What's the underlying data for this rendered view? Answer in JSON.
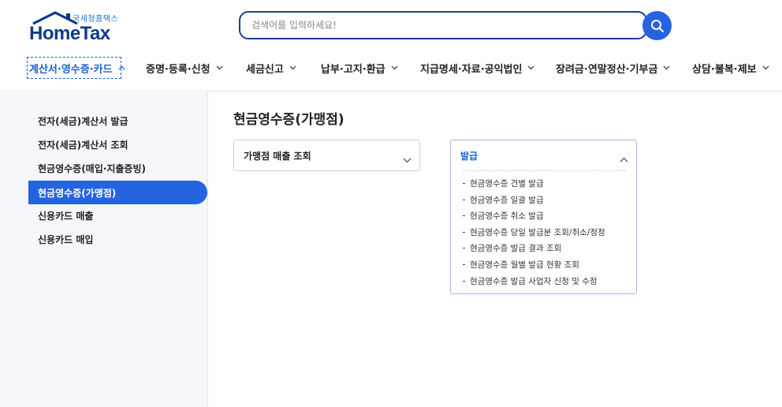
{
  "header": {
    "logo_sub": "국세청홈택스",
    "logo_main": "HomeTax",
    "search_placeholder": "검색어를 입력하세요!"
  },
  "nav": [
    {
      "label": "계산서·영수증·카드",
      "active": true
    },
    {
      "label": "증명·등록·신청"
    },
    {
      "label": "세금신고"
    },
    {
      "label": "납부·고지·환급"
    },
    {
      "label": "지급명세·자료·공익법인"
    },
    {
      "label": "장려금·연말정산·기부금"
    },
    {
      "label": "상담·불복·제보"
    }
  ],
  "sidebar": {
    "items": [
      {
        "label": "전자(세금)계산서 발급"
      },
      {
        "label": "전자(세금)계산서 조회"
      },
      {
        "label": "현금영수증(매입·지출증빙)"
      },
      {
        "label": "현금영수증(가맹점)",
        "active": true
      },
      {
        "label": "신용카드 매출"
      },
      {
        "label": "신용카드 매입"
      }
    ]
  },
  "main": {
    "title": "현금영수증(가맹점)",
    "card1": {
      "label": "가맹점 매출 조회"
    },
    "card2": {
      "label": "발급",
      "items": [
        "현금영수증 건별 발급",
        "현금영수증 일괄 발급",
        "현금영수증 취소 발급",
        "현금영수증 당일 발급분 조회/취소/정정",
        "현금영수증 발급 결과 조회",
        "현금영수증 월별 발급 현황 조회",
        "현금영수증 발급 사업자 신청 및 수정"
      ]
    }
  },
  "colors": {
    "primary": "#2563e0",
    "nav_active": "#1c5fcf",
    "highlight": "#ffff00",
    "search_border": "#1c3f8e"
  },
  "icons": {
    "search": "search-icon",
    "chevron_down": "chevron-down-icon",
    "chevron_up": "chevron-up-icon"
  }
}
